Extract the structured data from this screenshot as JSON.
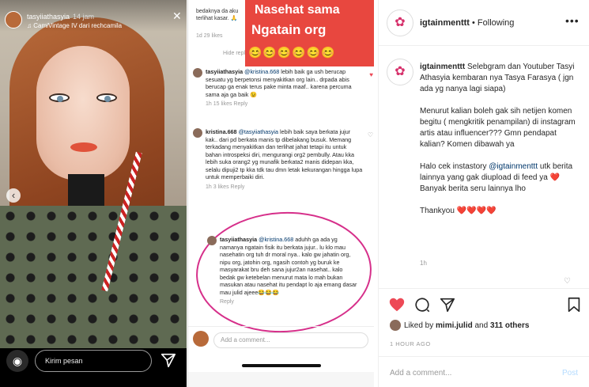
{
  "story": {
    "username": "tasyiiathasyia",
    "time": "14 jam",
    "subtitle": "♫ CamiVintage IV dari rechcamila",
    "message_placeholder": "Kirim pesan",
    "icons": [
      "camera-icon",
      "send-icon",
      "chevron-left-icon",
      "close-icon"
    ]
  },
  "comments_screen": {
    "banner_line1": "Nasehat sama",
    "banner_line2": "Ngatain org",
    "emojis": "😊😊😊😊😊😊",
    "top_text": "bedaknya da aku terlihat kasar. 🙏",
    "top_meta": "1d  29 likes",
    "hide_replies": "Hide replies",
    "comments": [
      {
        "user": "tasyiiathasyia",
        "mention": "@kristina.668",
        "text": "lebih baik ga ush berucap sesuatu yg berpetonsi menyakitkan org lain.. drpada abis berucap ga enak terus pake minta maaf.. karena percuma sama aja ga baik 😉",
        "meta": "1h  15 likes  Reply",
        "liked": true
      },
      {
        "user": "kristina.668",
        "mention": "@tasyiiathasyia",
        "text": "lebih baik saya berkata jujur kak.. dari pd berkata manis tp dibelakang busuk. Memang terkadang menyakitkan dan terlihat jahat tetapi itu untuk bahan introspeksi diri, mengurangi org2 pembully. Atau kka lebih suka orang2 yg munafik berkata2 manis didepan kka, selalu dipuji2 tp kka tdk tau dmn letak kekurangan hingga lupa untuk memperbaiki diri.",
        "meta": "1h  3 likes  Reply",
        "liked": false
      },
      {
        "user": "tasyiiathasyia",
        "mention": "@kristina.668",
        "text": "aduhh ga ada yg namanya ngatain fisik itu berkata jujur.. lu klo mau nasehatin org tuh dr moral nya.. kalo gw jahatin org, nipu org, jatohin org, ngasih contoh yg buruk ke masyarakat bru deh sana jujur2an nasehat.. kalo bedak gw ketebelan menurut mata lo mah bukan masukan atau nasehat itu pendapt lo aja emang dasar mau julid ajeee😂😂😂",
        "meta": "Reply",
        "liked": false
      }
    ],
    "add_comment": "Add a comment..."
  },
  "post": {
    "username": "igtainmenttt",
    "follow_state": "• Following",
    "caption_user": "igtainmenttt",
    "caption_p1": "Selebgram dan Youtuber Tasyi Athasyia kembaran nya Tasya Farasya ( jgn ada yg nanya lagi siapa)",
    "caption_p2": "Menurut kalian boleh gak sih netijen komen begitu ( mengkritik penampilan) di instagram artis atau influencer??? Gmn pendapat kalian? Komen dibawah ya",
    "caption_p3_pre": "Halo cek instastory",
    "caption_p3_mention": "@igtainmenttt",
    "caption_p3_post": "utk berita lainnya yang gak diupload di feed ya ❤️ Banyak berita seru lainnya lho",
    "caption_p4": "Thankyou ❤️❤️❤️❤️",
    "caption_time": "1h",
    "liked_by_prefix": "Liked by",
    "liked_by_user": "mimi.julid",
    "liked_by_and": "and",
    "liked_by_count": "311 others",
    "post_time": "1 HOUR AGO",
    "add_comment": "Add a comment...",
    "post_button": "Post",
    "colors": {
      "heart": "#ed4956",
      "link": "#00376b",
      "post_disabled": "#b3dbff"
    }
  }
}
